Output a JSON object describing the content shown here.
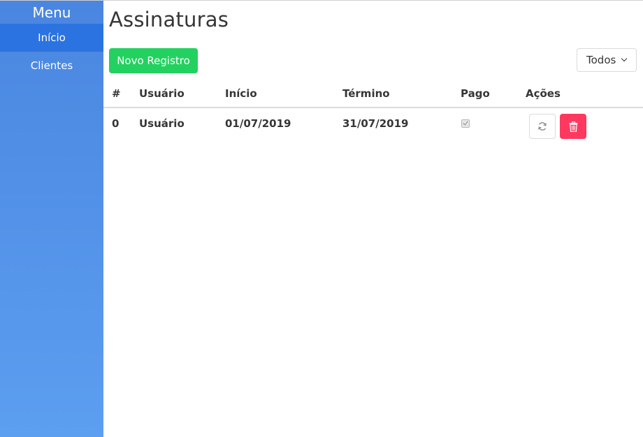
{
  "sidebar": {
    "title": "Menu",
    "items": [
      {
        "label": "Início",
        "active": true
      },
      {
        "label": "Clientes",
        "active": false
      }
    ]
  },
  "main": {
    "title": "Assinaturas",
    "new_button_label": "Novo Registro",
    "filter": {
      "selected": "Todos"
    },
    "table": {
      "columns": [
        "#",
        "Usuário",
        "Início",
        "Término",
        "Pago",
        "Ações"
      ],
      "rows": [
        {
          "id": "0",
          "usuario": "Usuário",
          "inicio": "01/07/2019",
          "termino": "31/07/2019",
          "pago": true
        }
      ]
    }
  },
  "colors": {
    "sidebar_active": "#2a73e0",
    "sidebar": "#4a86e0",
    "success": "#23d160",
    "danger": "#ff3860"
  },
  "icons": {
    "refresh": "refresh-icon",
    "delete": "trash-icon",
    "dropdown": "chevron-down-icon"
  }
}
